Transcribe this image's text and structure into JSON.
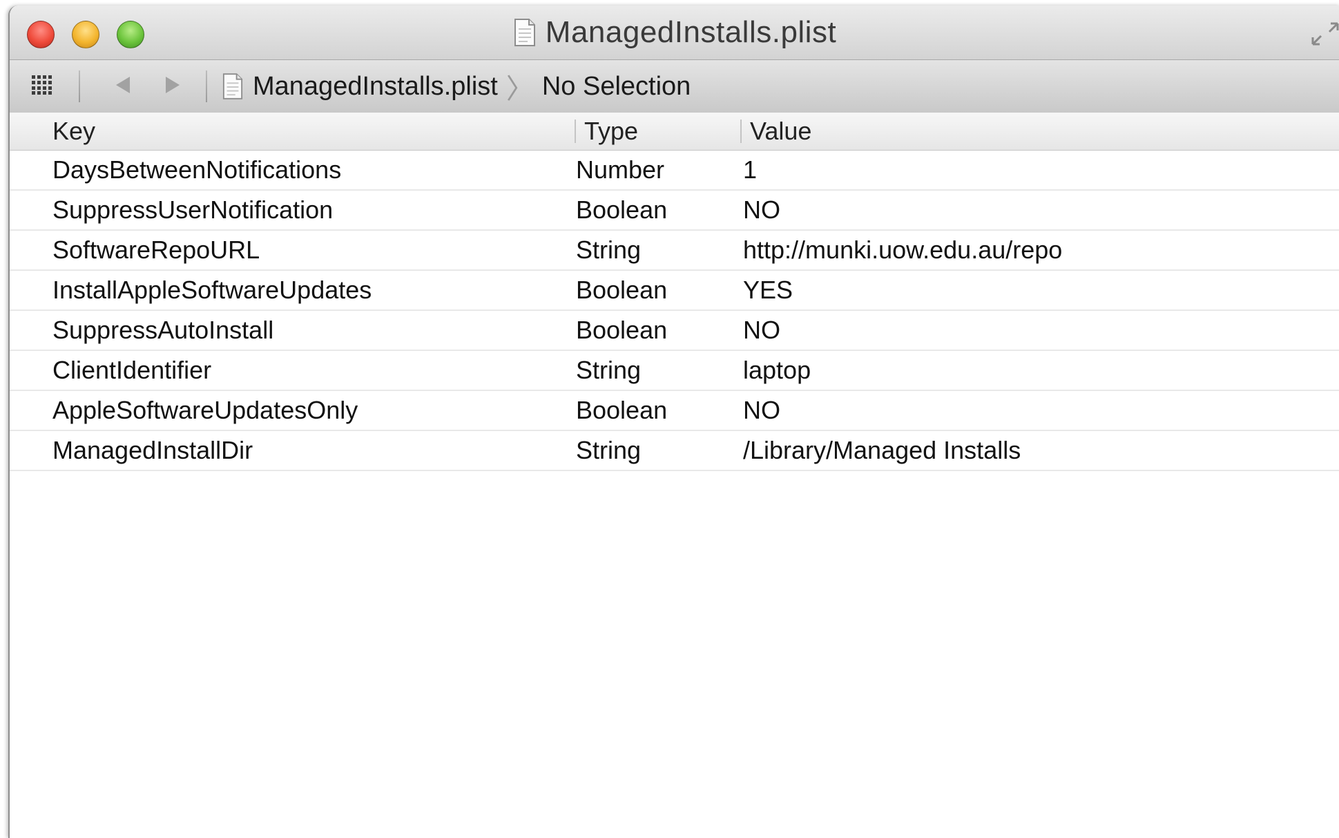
{
  "window": {
    "title": "ManagedInstalls.plist"
  },
  "toolbar": {
    "icons": [
      "grid-icon",
      "back-arrow-icon",
      "forward-arrow-icon",
      "document-icon"
    ],
    "breadcrumb": {
      "file": "ManagedInstalls.plist",
      "separator": "〉",
      "selection": "No Selection"
    }
  },
  "table": {
    "columns": {
      "key": "Key",
      "type": "Type",
      "value": "Value"
    },
    "rows": [
      {
        "key": "DaysBetweenNotifications",
        "type": "Number",
        "value": "1"
      },
      {
        "key": "SuppressUserNotification",
        "type": "Boolean",
        "value": "NO"
      },
      {
        "key": "SoftwareRepoURL",
        "type": "String",
        "value": "http://munki.uow.edu.au/repo"
      },
      {
        "key": "InstallAppleSoftwareUpdates",
        "type": "Boolean",
        "value": "YES"
      },
      {
        "key": "SuppressAutoInstall",
        "type": "Boolean",
        "value": "NO"
      },
      {
        "key": "ClientIdentifier",
        "type": "String",
        "value": "laptop"
      },
      {
        "key": "AppleSoftwareUpdatesOnly",
        "type": "Boolean",
        "value": "NO"
      },
      {
        "key": "ManagedInstallDir",
        "type": "String",
        "value": "/Library/Managed Installs"
      }
    ]
  },
  "colors": {
    "close": "#ef4b3b",
    "minimize": "#f3b52e",
    "zoom": "#6cc43c",
    "row_divider": "#e8e8e8"
  }
}
